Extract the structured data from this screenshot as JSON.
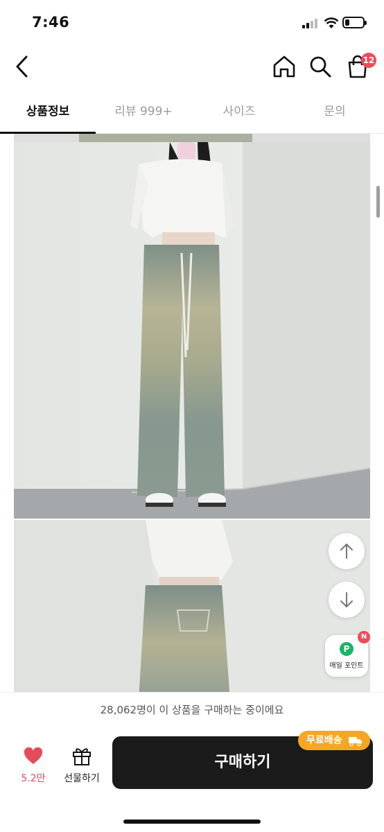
{
  "status_bar": {
    "time": "7:46"
  },
  "header": {
    "cart_badge": "12",
    "icons": [
      "back-chevron-icon",
      "home-icon",
      "search-icon",
      "shopping-bag-icon"
    ]
  },
  "tabs": [
    {
      "label": "상품정보",
      "active": true
    },
    {
      "label": "리뷰 999+",
      "active": false
    },
    {
      "label": "사이즈",
      "active": false
    },
    {
      "label": "문의",
      "active": false
    }
  ],
  "floating": {
    "points_icon_letter": "P",
    "points_label": "매일 포인트",
    "points_new_badge": "N"
  },
  "buying_notice": "28,062명이 이 상품을 구매하는 중이에요",
  "bottom_bar": {
    "like_count": "5.2만",
    "gift_label": "선물하기",
    "buy_label": "구매하기",
    "free_shipping_label": "무료배송"
  },
  "colors": {
    "accent_red": "#ee4b5a",
    "buy_button": "#1b1b1b",
    "free_shipping": "#f5a623",
    "points_green": "#1bb36a"
  }
}
